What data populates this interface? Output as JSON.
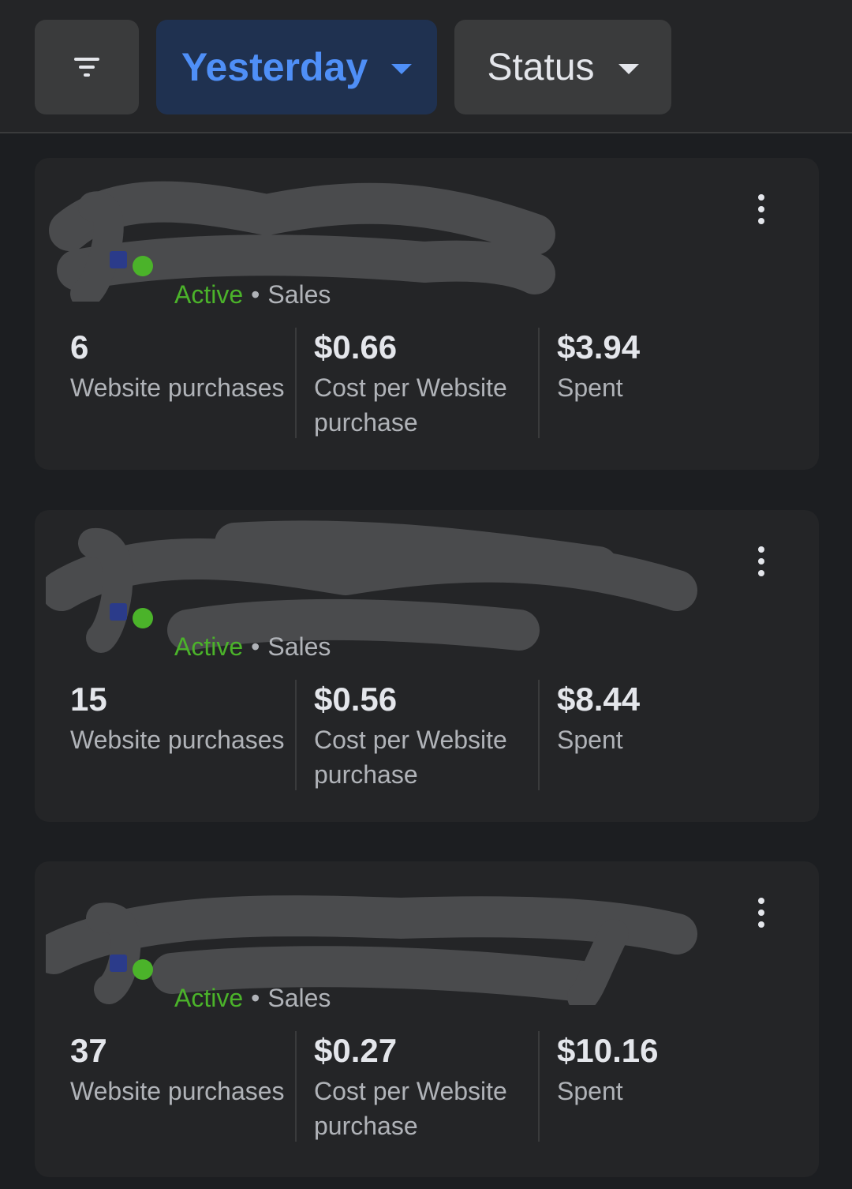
{
  "toolbar": {
    "filter_icon": "filter-icon",
    "date_label": "Yesterday",
    "status_label": "Status"
  },
  "colors": {
    "accent": "#4f8ff7",
    "active": "#4bb32a",
    "background": "#1c1e21",
    "card": "#242527"
  },
  "campaigns": [
    {
      "status": "Active",
      "objective": "Sales",
      "purchases": "6",
      "purchases_label": "Website purchases",
      "cost_per": "$0.66",
      "cost_per_label": "Cost per Website purchase",
      "spent": "$3.94",
      "spent_label": "Spent"
    },
    {
      "status": "Active",
      "objective": "Sales",
      "purchases": "15",
      "purchases_label": "Website purchases",
      "cost_per": "$0.56",
      "cost_per_label": "Cost per Website purchase",
      "spent": "$8.44",
      "spent_label": "Spent"
    },
    {
      "status": "Active",
      "objective": "Sales",
      "purchases": "37",
      "purchases_label": "Website purchases",
      "cost_per": "$0.27",
      "cost_per_label": "Cost per Website purchase",
      "spent": "$10.16",
      "spent_label": "Spent"
    }
  ]
}
